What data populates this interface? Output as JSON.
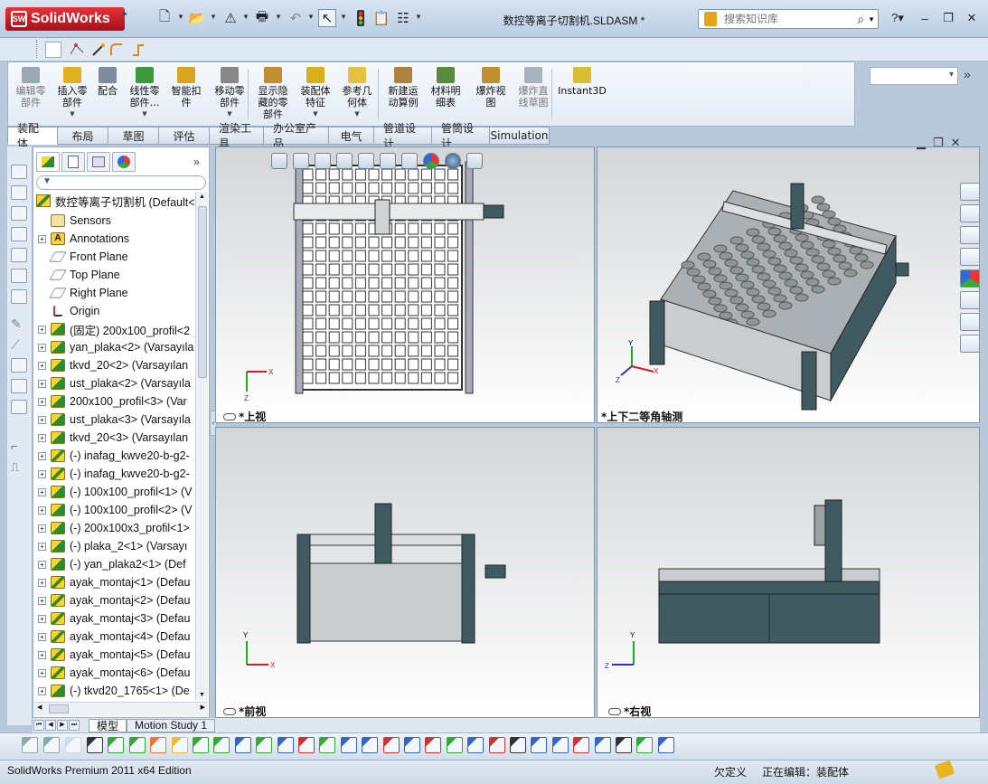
{
  "app": {
    "logo_text": "SolidWorks",
    "logo_mark": "SW",
    "doc_title": "数控等离子切割机.SLDASM *",
    "search_placeholder": "搜索知识库",
    "win_controls": [
      "–",
      "❐",
      "✕"
    ]
  },
  "command_manager": {
    "items": [
      {
        "label": "编辑零\n部件",
        "dim": true,
        "color": "#9aa7b5"
      },
      {
        "label": "插入零\n部件",
        "dim": false,
        "color": "#e0b020",
        "dropdown": true
      },
      {
        "label": "配合",
        "dim": false,
        "color": "#7b8c9e"
      },
      {
        "label": "线性零\n部件…",
        "dim": false,
        "color": "#3c9a3c",
        "dropdown": true
      },
      {
        "label": "智能扣\n件",
        "dim": false,
        "color": "#d9a520"
      },
      {
        "label": "移动零\n部件",
        "dim": false,
        "color": "#888",
        "dropdown": true
      },
      {
        "label": "显示隐\n藏的零\n部件",
        "dim": false,
        "color": "#c48d2d"
      },
      {
        "label": "装配体\n特征",
        "dim": false,
        "color": "#d8b01c",
        "dropdown": true
      },
      {
        "label": "参考几\n何体",
        "dim": false,
        "color": "#e8c040",
        "dropdown": true
      },
      {
        "label": "新建运\n动算例",
        "dim": false,
        "color": "#b08040"
      },
      {
        "label": "材料明\n细表",
        "dim": false,
        "color": "#5a8a3a"
      },
      {
        "label": "爆炸视\n图",
        "dim": false,
        "color": "#c09030"
      },
      {
        "label": "爆炸直\n线草图",
        "dim": true,
        "color": "#a7b3c0"
      },
      {
        "label": "Instant3D",
        "dim": false,
        "color": "#d9bf30"
      }
    ]
  },
  "tabs": [
    "装配体",
    "布局",
    "草图",
    "评估",
    "渲染工具",
    "办公室产品",
    "电气",
    "管道设计",
    "管筒设计",
    "Simulation"
  ],
  "active_tab_index": 0,
  "feature_tree": {
    "root": "数控等离子切割机  (Default<",
    "rows": [
      {
        "icon": "sensor",
        "text": "Sensors"
      },
      {
        "icon": "annot",
        "text": "Annotations",
        "expander": "+"
      },
      {
        "icon": "plane",
        "text": "Front Plane"
      },
      {
        "icon": "plane",
        "text": "Top Plane"
      },
      {
        "icon": "plane",
        "text": "Right Plane"
      },
      {
        "icon": "origin",
        "text": "Origin"
      },
      {
        "icon": "part",
        "text": "(固定) 200x100_profil<2",
        "expander": "+"
      },
      {
        "icon": "part",
        "text": "yan_plaka<2> (Varsayıla",
        "expander": "+"
      },
      {
        "icon": "part",
        "text": "tkvd_20<2> (Varsayılan",
        "expander": "+"
      },
      {
        "icon": "part",
        "text": "ust_plaka<2> (Varsayıla",
        "expander": "+"
      },
      {
        "icon": "part",
        "text": "200x100_profil<3> (Var",
        "expander": "+"
      },
      {
        "icon": "part",
        "text": "ust_plaka<3> (Varsayıla",
        "expander": "+"
      },
      {
        "icon": "part",
        "text": "tkvd_20<3> (Varsayılan",
        "expander": "+"
      },
      {
        "icon": "asm",
        "text": "(-) inafag_kwve20-b-g2-",
        "expander": "+"
      },
      {
        "icon": "asm",
        "text": "(-) inafag_kwve20-b-g2-",
        "expander": "+"
      },
      {
        "icon": "part",
        "text": "(-) 100x100_profil<1> (V",
        "expander": "+"
      },
      {
        "icon": "part",
        "text": "(-) 100x100_profil<2> (V",
        "expander": "+"
      },
      {
        "icon": "part",
        "text": "(-) 200x100x3_profil<1>",
        "expander": "+"
      },
      {
        "icon": "part",
        "text": "(-) plaka_2<1> (Varsayı",
        "expander": "+"
      },
      {
        "icon": "part",
        "text": "(-) yan_plaka2<1> (Def",
        "expander": "+"
      },
      {
        "icon": "asm",
        "text": "ayak_montaj<1> (Defau",
        "expander": "+"
      },
      {
        "icon": "asm",
        "text": "ayak_montaj<2> (Defau",
        "expander": "+"
      },
      {
        "icon": "asm",
        "text": "ayak_montaj<3> (Defau",
        "expander": "+"
      },
      {
        "icon": "asm",
        "text": "ayak_montaj<4> (Defau",
        "expander": "+"
      },
      {
        "icon": "asm",
        "text": "ayak_montaj<5> (Defau",
        "expander": "+"
      },
      {
        "icon": "asm",
        "text": "ayak_montaj<6> (Defau",
        "expander": "+"
      },
      {
        "icon": "part",
        "text": "(-) tkvd20_1765<1> (De",
        "expander": "+"
      }
    ]
  },
  "viewports": {
    "top_left": "*上视",
    "top_right": "*上下二等角轴测",
    "bottom_left": "*前视",
    "bottom_right": "*右视"
  },
  "bottom_tabs": {
    "model": "模型",
    "motion": "Motion Study 1"
  },
  "status": {
    "edition": "SolidWorks Premium 2011 x64 Edition",
    "definition": "欠定义",
    "editing": "正在编辑：装配体"
  },
  "colors": {
    "machine_steel": "#3f5a60",
    "machine_light": "#c9cdd0",
    "grid_dark": "#333",
    "accent_red": "#c0262d"
  }
}
